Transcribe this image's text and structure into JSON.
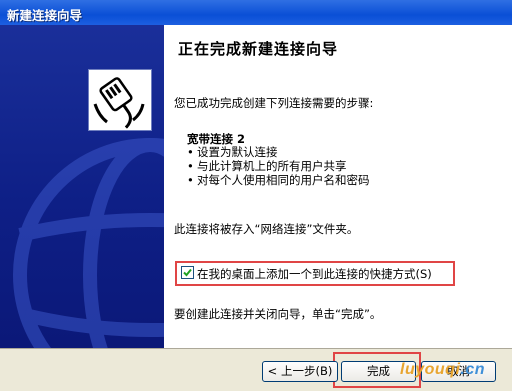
{
  "window": {
    "title": "新建连接向导"
  },
  "colors": {
    "side_panel": "#0e1f86",
    "titlebar": "#0a4fd6",
    "highlight_border": "#e04545",
    "face": "#ece9d8"
  },
  "icons": {
    "logo": "network-cable-icon",
    "check": "checkmark-icon"
  },
  "content": {
    "title": "正在完成新建连接向导",
    "intro": "您已成功完成创建下列连接需要的步骤:",
    "connection_name": "宽带连接 2",
    "bullets": [
      "设置为默认连接",
      "与此计算机上的所有用户共享",
      "对每个人使用相同的用户名和密码"
    ],
    "save_note": "此连接将被存入“网络连接”文件夹。",
    "shortcut_checkbox": {
      "label": "在我的桌面上添加一个到此连接的快捷方式(S)",
      "checked": true
    },
    "finish_note": "要创建此连接并关闭向导，单击“完成”。"
  },
  "buttons": {
    "back": "< 上一步(B)",
    "finish": "完成",
    "cancel": "取消"
  },
  "watermark": {
    "part1": "lu",
    "part2": "youqi",
    "part3": ".cn"
  }
}
